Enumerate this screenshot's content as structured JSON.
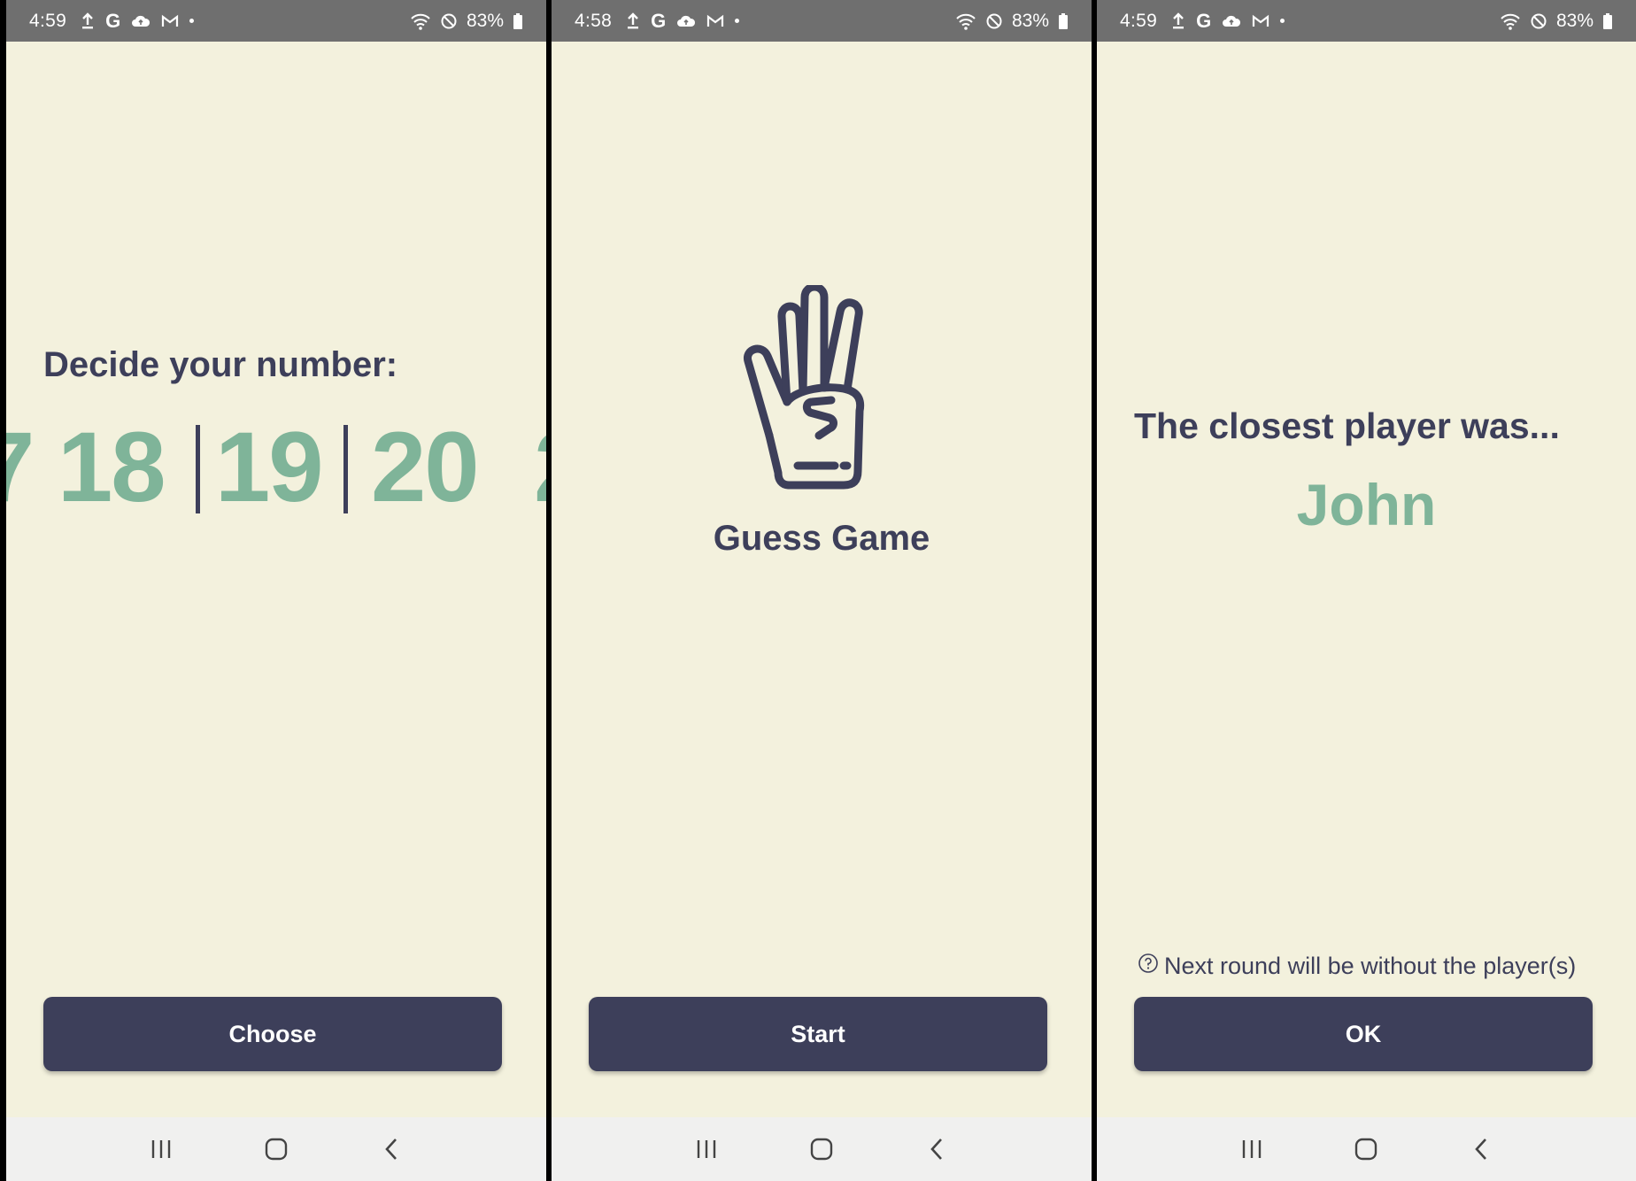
{
  "colors": {
    "background": "#f3f1dd",
    "primary": "#3d3f5a",
    "accent": "#7fb499",
    "status_bar": "#6f6f6f",
    "nav_bar": "#f0f0ef"
  },
  "status_bars": [
    {
      "time": "4:59",
      "battery": "83%"
    },
    {
      "time": "4:58",
      "battery": "83%"
    },
    {
      "time": "4:59",
      "battery": "83%"
    }
  ],
  "status_icons": [
    "upload-icon",
    "google-icon",
    "cloud-icon",
    "gmail-icon",
    "notification-dot-icon",
    "wifi-icon",
    "do-not-disturb-icon",
    "battery-icon"
  ],
  "nav_icons": [
    "recents-icon",
    "home-icon",
    "back-icon"
  ],
  "screen_choose": {
    "heading": "Decide your number:",
    "numbers": [
      "7",
      "18",
      "19",
      "20",
      "2"
    ],
    "button_label": "Choose"
  },
  "screen_start": {
    "app_icon": "hand-three-fingers-icon",
    "title": "Guess Game",
    "button_label": "Start"
  },
  "screen_result": {
    "heading": "The closest player was...",
    "winner": "John",
    "hint_icon": "question-circle-icon",
    "hint": "Next round will be without the player(s)",
    "button_label": "OK"
  }
}
